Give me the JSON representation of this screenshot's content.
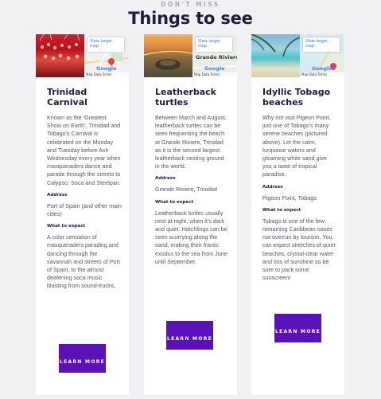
{
  "header": {
    "kicker": "DON'T MISS",
    "title": "Things to see"
  },
  "cards": [
    {
      "title": "Trinidad Carnival",
      "description": "Known as the ‘Greatest Show on Earth’, Trinidad and Tobago’s Carnival is celebrated on the Monday and Tuesday before Ash Wednesday every year when masqueraders dance and parade through the streets to Calypso, Soca and Steelpan.",
      "address_label": "Address",
      "address": "Port of Spain (and other main cities)",
      "expect_label": "What to expect",
      "expect": "A color sensation of masqueraders parading and dancing through the savannah and streets of Port of Spain, to the almost deafening soca music blasting from sound-trucks.",
      "button": "LEARN MORE",
      "map": {
        "link": "View larger map",
        "place": "",
        "attribution": "Map Data Terms",
        "logo": "Google"
      }
    },
    {
      "title": "Leatherback turtles",
      "description": "Between March and August, leatherback turtles can be seen frequenting the beach at Grande Riviere, Trinidad as it is the second largest leatherback nesting ground in the world.",
      "address_label": "Address",
      "address": "Grande Riviere, Trinidad",
      "expect_label": "What to expect",
      "expect": "Leatherback turtles usually nest at night, when it’s dark and quiet. Hatchlings can be seen scurrying along the sand, making their frantic exodus to the sea from June until September.",
      "button": "LEARN MORE",
      "map": {
        "link": "View larger map",
        "place": "Grande Riviere",
        "attribution": "Map Data Terms",
        "logo": "Google"
      }
    },
    {
      "title": "Idyllic Tobago beaches",
      "description": "Why not visit Pigeon Point, just one of Tobago’s many serene beaches (pictured above). Let the calm, turquoise waters and gleaming white sand give you a taste of tropical paradise.",
      "address_label": "Address",
      "address": "Pigeon Point, Tobago",
      "expect_label": "What to expect",
      "expect": "Tobago is one of the few remaining Caribbean oases not overrun by tourism. You can expect stretches of quiet beaches, crystal-clear water and lots of sunshine so be sure to pack some sunscreen!",
      "button": "LEARN MORE",
      "map": {
        "link": "View larger map",
        "place": "",
        "attribution": "Map Data Terms",
        "logo": "Google"
      }
    }
  ],
  "colors": {
    "accent": "#5a12b8",
    "heading": "#1f1b3d",
    "background": "#f1f1f3"
  },
  "icons": [
    "map-pin-icon"
  ]
}
